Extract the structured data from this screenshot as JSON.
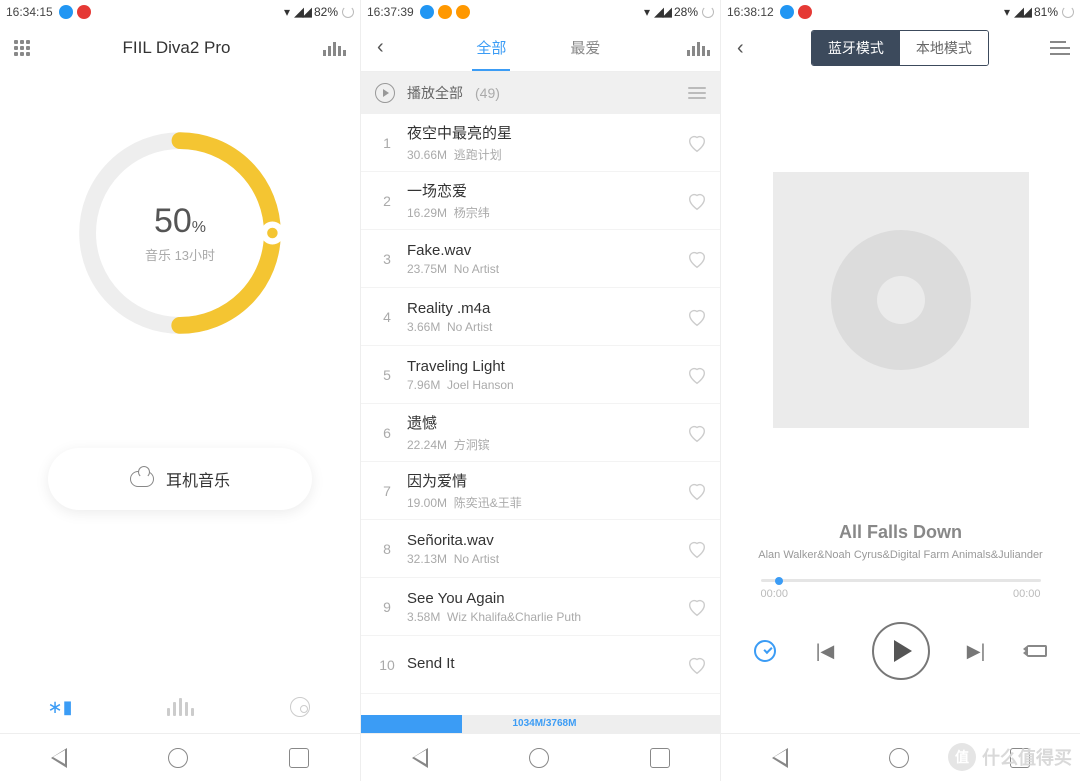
{
  "watermark": "什么值得买",
  "watermark_badge": "值",
  "screen1": {
    "status": {
      "time": "16:34:15",
      "battery": "82%"
    },
    "title": "FIIL Diva2 Pro",
    "battery_pct": "50",
    "battery_unit": "%",
    "battery_sub": "音乐 13小时",
    "music_card": "耳机音乐"
  },
  "screen2": {
    "status": {
      "time": "16:37:39",
      "battery": "28%"
    },
    "tabs": {
      "all": "全部",
      "fav": "最爱"
    },
    "playall_label": "播放全部",
    "playall_count": "(49)",
    "storage_label": "1034M/3768M",
    "songs": [
      {
        "idx": "1",
        "name": "夜空中最亮的星",
        "size": "30.66M",
        "artist": "逃跑计划"
      },
      {
        "idx": "2",
        "name": "一场恋爱",
        "size": "16.29M",
        "artist": "杨宗纬"
      },
      {
        "idx": "3",
        "name": "Fake.wav",
        "size": "23.75M",
        "artist": "No Artist"
      },
      {
        "idx": "4",
        "name": "Reality .m4a",
        "size": "3.66M",
        "artist": "No Artist"
      },
      {
        "idx": "5",
        "name": "Traveling Light",
        "size": "7.96M",
        "artist": "Joel Hanson"
      },
      {
        "idx": "6",
        "name": "遗憾",
        "size": "22.24M",
        "artist": "方泂镔"
      },
      {
        "idx": "7",
        "name": "因为爱情",
        "size": "19.00M",
        "artist": "陈奕迅&王菲"
      },
      {
        "idx": "8",
        "name": "Señorita.wav",
        "size": "32.13M",
        "artist": "No Artist"
      },
      {
        "idx": "9",
        "name": "See You Again",
        "size": "3.58M",
        "artist": "Wiz Khalifa&Charlie Puth"
      },
      {
        "idx": "10",
        "name": "Send It",
        "size": "",
        "artist": ""
      }
    ]
  },
  "screen3": {
    "status": {
      "time": "16:38:12",
      "battery": "81%"
    },
    "seg_bt": "蓝牙模式",
    "seg_local": "本地模式",
    "now_title": "All Falls Down",
    "now_artist": "Alan Walker&Noah Cyrus&Digital Farm Animals&Juliander",
    "time_current": "00:00",
    "time_total": "00:00"
  }
}
